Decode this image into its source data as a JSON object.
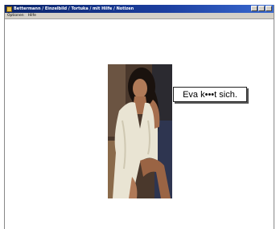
{
  "window": {
    "title": "Bettermann / Einzelbild / Tortuka / mit Hilfe / Notizen",
    "icon": "app-icon"
  },
  "menu": {
    "items": [
      {
        "label": "Optionen"
      },
      {
        "label": "Hilfe"
      }
    ]
  },
  "viewer": {
    "caption": "Eva k•••t sich.",
    "image": "photo-of-woman-in-white-robe"
  },
  "colors": {
    "titlebar": "#0a246a",
    "menubar": "#d4d0c8",
    "background": "#ffffff"
  }
}
